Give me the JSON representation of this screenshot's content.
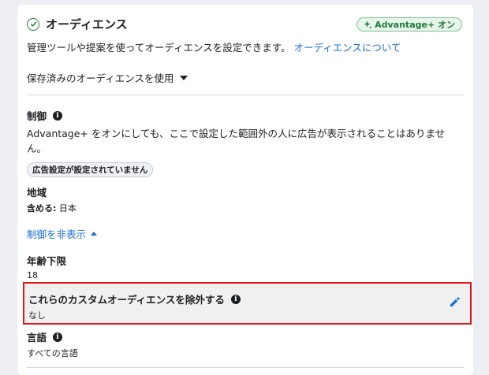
{
  "header": {
    "title": "オーディエンス",
    "badge": "Advantage+ オン",
    "description": "管理ツールや提案を使ってオーディエンスを設定できます。",
    "about_link": "オーディエンスについて"
  },
  "saved_audience": {
    "label": "保存済みのオーディエンスを使用"
  },
  "controls": {
    "title": "制御",
    "note": "Advantage+ をオンにしても、ここで設定した範囲外の人に広告が表示されることはありません。",
    "pill": "広告設定が設定されていません"
  },
  "location": {
    "title": "地域",
    "include_label": "含める:",
    "include_value": "日本"
  },
  "hide_controls": "制御を非表示",
  "min_age": {
    "title": "年齢下限",
    "value": "18"
  },
  "exclude": {
    "title": "これらのカスタムオーディエンスを除外する",
    "value": "なし"
  },
  "language": {
    "title": "言語",
    "value": "すべての言語"
  },
  "colors": {
    "accent": "#1a6ed8",
    "highlight_border": "#e0161b",
    "success": "#1d7a3c"
  }
}
